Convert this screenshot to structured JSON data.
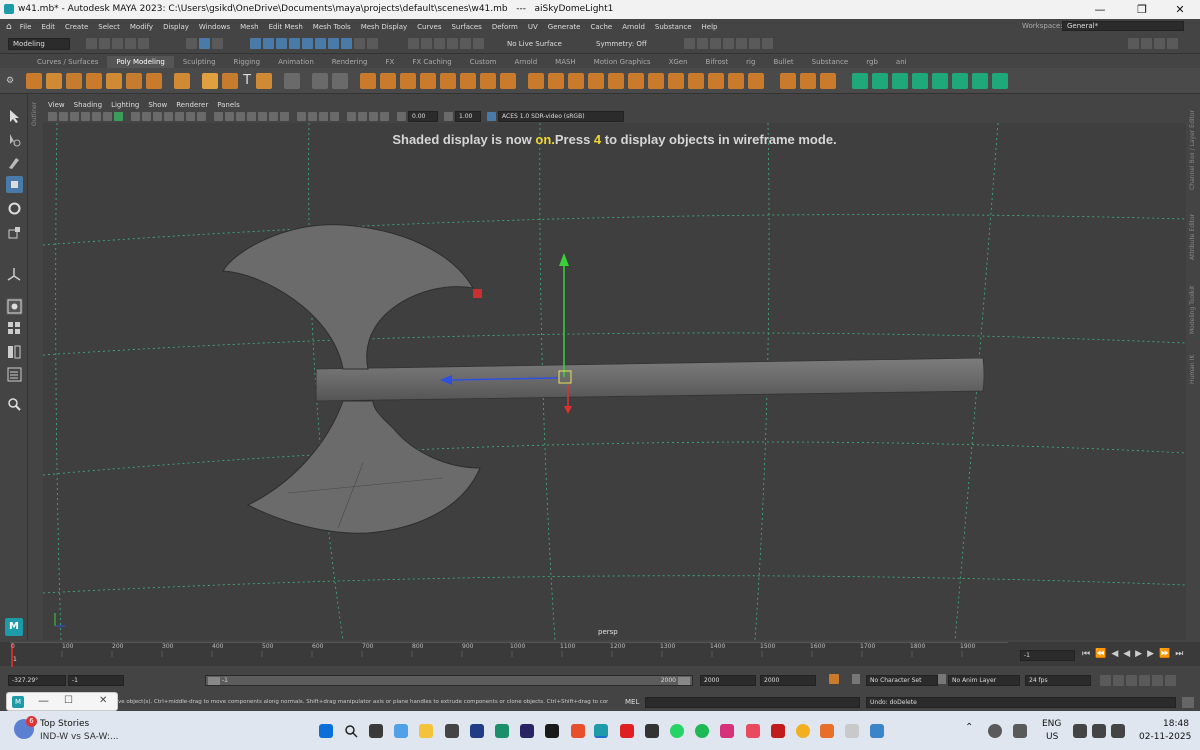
{
  "window": {
    "title": "w41.mb* - Autodesk MAYA 2023: C:\\Users\\gsikd\\OneDrive\\Documents\\maya\\projects\\default\\scenes\\w41.mb   ---   aiSkyDomeLight1",
    "minimize": "—",
    "maximize": "❐",
    "close": "✕"
  },
  "menubar": {
    "items": [
      "File",
      "Edit",
      "Create",
      "Select",
      "Modify",
      "Display",
      "Windows",
      "Mesh",
      "Edit Mesh",
      "Mesh Tools",
      "Mesh Display",
      "Curves",
      "Surfaces",
      "Deform",
      "UV",
      "Generate",
      "Cache",
      "Arnold",
      "Substance",
      "Help"
    ],
    "workspace_label": "Workspace:",
    "workspace_value": "General*"
  },
  "statusline": {
    "mode": "Modeling",
    "live_surface": "No Live Surface",
    "symmetry": "Symmetry: Off"
  },
  "shelf": {
    "tabs": [
      "Curves / Surfaces",
      "Poly Modeling",
      "Sculpting",
      "Rigging",
      "Animation",
      "Rendering",
      "FX",
      "FX Caching",
      "Custom",
      "Arnold",
      "MASH",
      "Motion Graphics",
      "XGen",
      "Bifrost",
      "rig",
      "Bullet",
      "Substance",
      "rgb",
      "ani"
    ],
    "active_tab": "Poly Modeling"
  },
  "panel": {
    "menus": [
      "View",
      "Shading",
      "Lighting",
      "Show",
      "Renderer",
      "Panels"
    ],
    "field_a": "0.00",
    "field_b": "1.00",
    "colorspace": "ACES 1.0 SDR-video (sRGB)",
    "camera_name": "persp",
    "outliner_label": "Outliner"
  },
  "hud": {
    "msg_part1": "Shaded display is now ",
    "msg_on": "on.",
    "msg_part2": "Press ",
    "msg_key": "4",
    "msg_part3": " to display objects in wireframe mode."
  },
  "side_labels": [
    "Channel Box / Layer Editor",
    "Attribute Editor",
    "Modeling Toolkit",
    "Human IK"
  ],
  "timeline": {
    "ticks": [
      "0",
      "100",
      "200",
      "300",
      "400",
      "500",
      "600",
      "700",
      "800",
      "900",
      "1000",
      "1100",
      "1200",
      "1300",
      "1400",
      "1500",
      "1600",
      "1700",
      "1800",
      "1900"
    ],
    "start_frame": "1",
    "current_frame": "-1"
  },
  "range": {
    "field1": "-327.29°",
    "field2": "-1",
    "slider_start": "-1",
    "slider_end": "2000",
    "range_end": "2000",
    "anim_end": "2000",
    "character_set": "No Character Set",
    "anim_layer": "No Anim Layer",
    "fps": "24 fps"
  },
  "cmdline": {
    "help_text": "ve object(s). Ctrl+middle-drag to move components along normals. Shift+drag manipulator axis or plane handles to extrude components or clone objects. Ctrl+Shift+drag to con",
    "lang": "MEL",
    "result": "Undo: doDelete"
  },
  "taskbar": {
    "news_badge": "6",
    "news_title": "Top Stories",
    "news_sub": "IND-W vs SA-W:...",
    "lang1": "ENG",
    "lang2": "US",
    "time": "18:48",
    "date": "02-11-2025"
  },
  "colors": {
    "accent_blue": "#4a7ba8",
    "hud_highlight": "#f0d62e",
    "grid_line": "#3ecf8e",
    "axe_surface": "#6e6e6e"
  }
}
